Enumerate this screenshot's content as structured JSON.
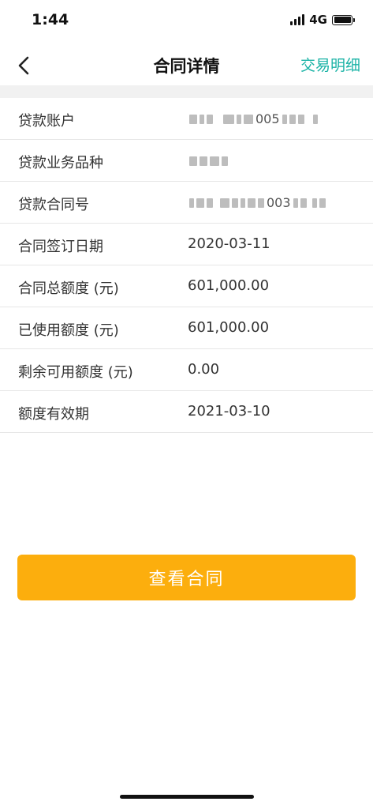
{
  "status_bar": {
    "time": "1:44",
    "network": "4G",
    "icons": [
      "signal-icon",
      "battery-icon"
    ]
  },
  "nav": {
    "title": "合同详情",
    "action_label": "交易明细",
    "back_icon": "chevron-left-icon"
  },
  "details": {
    "rows": [
      {
        "label": "贷款账户",
        "value": "",
        "masked": true,
        "visible_fragment": "005"
      },
      {
        "label": "贷款业务品种",
        "value": "",
        "masked": true,
        "visible_fragment": ""
      },
      {
        "label": "贷款合同号",
        "value": "",
        "masked": true,
        "visible_fragment": "003"
      },
      {
        "label": "合同签订日期",
        "value": "2020-03-11"
      },
      {
        "label": "合同总额度 (元)",
        "value": "601,000.00"
      },
      {
        "label": "已使用额度 (元)",
        "value": "601,000.00"
      },
      {
        "label": "剩余可用额度 (元)",
        "value": "0.00"
      },
      {
        "label": "额度有效期",
        "value": "2021-03-10"
      }
    ]
  },
  "primary_button": {
    "label": "查看合同"
  },
  "colors": {
    "accent": "#1bb3a6",
    "button": "#fcae0d",
    "divider_band": "#f1f1f1"
  }
}
